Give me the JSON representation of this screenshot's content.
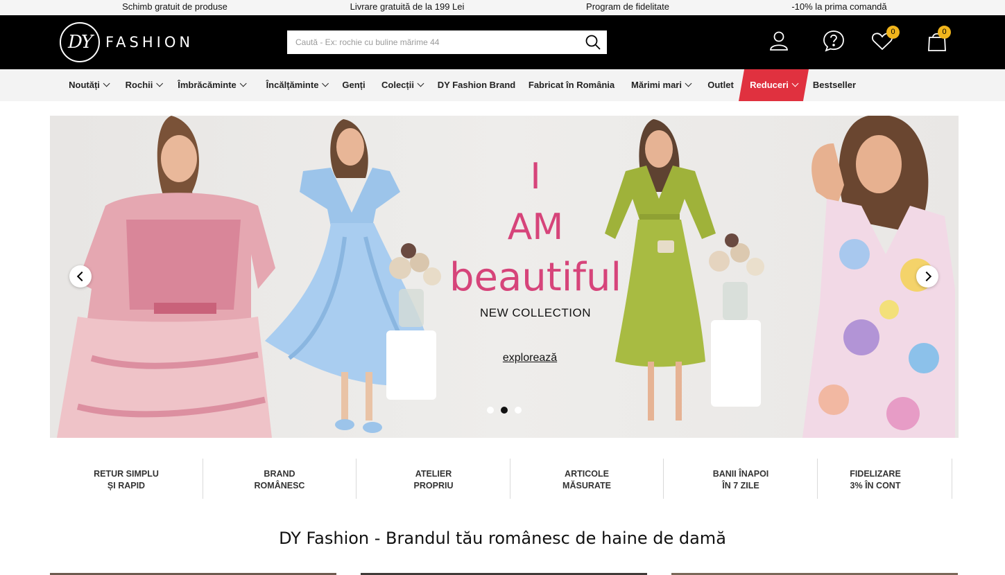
{
  "promo_bar": {
    "items": [
      "Schimb gratuit de produse",
      "Livrare gratuită de la 199 Lei",
      "Program de fidelitate",
      "-10% la prima comandă"
    ]
  },
  "header": {
    "logo_monogram": "DY",
    "logo_word": "FASHION",
    "search_placeholder": "Caută - Ex: rochie cu buline mărime 44",
    "icons": [
      "user-icon",
      "help-icon",
      "heart-icon",
      "cart-icon"
    ],
    "wishlist_count": "0",
    "cart_count": "0",
    "badge_color": "#f1b51c"
  },
  "nav": {
    "items": [
      "Noutăți",
      "Rochii",
      "Îmbrăcăminte",
      "Încălțăminte",
      "Genți",
      "Colecții",
      "DY Fashion Brand",
      "Fabricat în România",
      "Mărimi mari",
      "Outlet",
      "Reduceri",
      "Bestseller"
    ],
    "sale_color": "#e0313f"
  },
  "hero": {
    "line1": "I",
    "line2": "AM",
    "line3": "beautiful",
    "subtitle": "NEW COLLECTION",
    "cta": "explorează",
    "title_color": "#d6447a",
    "slides_total": 3,
    "active_slide": 2
  },
  "usps": [
    {
      "line1": "RETUR SIMPLU",
      "line2": "ȘI RAPID"
    },
    {
      "line1": "BRAND",
      "line2": "ROMÂNESC"
    },
    {
      "line1": "ATELIER",
      "line2": "PROPRIU"
    },
    {
      "line1": "ARTICOLE",
      "line2": "MĂSURATE"
    },
    {
      "line1": "BANII ÎNAPOI",
      "line2": "ÎN 7 ZILE"
    },
    {
      "line1": "FIDELIZARE",
      "line2": "3% ÎN CONT"
    }
  ],
  "tagline": "DY Fashion - Brandul tău românesc de haine de damă"
}
